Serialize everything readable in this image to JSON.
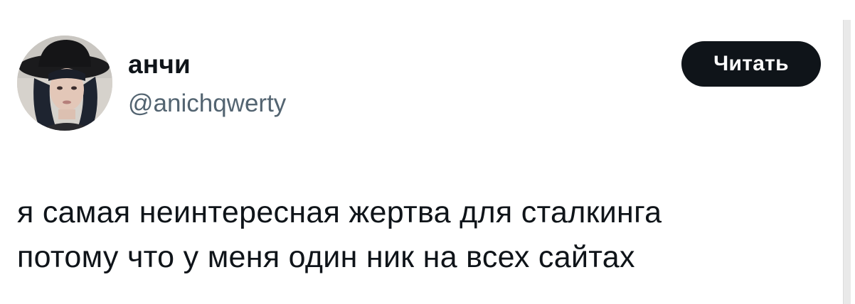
{
  "author": {
    "display_name": "анчи",
    "handle": "@anichqwerty",
    "avatar": "profile-photo"
  },
  "follow_button": {
    "label": "Читать"
  },
  "tweet": {
    "lines": [
      "я самая неинтересная жертва для сталкинга",
      "потому что у меня один ник на всех сайтах"
    ]
  },
  "colors": {
    "text_primary": "#0f1419",
    "text_secondary": "#536471",
    "button_bg": "#0f1419",
    "button_text": "#ffffff",
    "background": "#ffffff"
  }
}
